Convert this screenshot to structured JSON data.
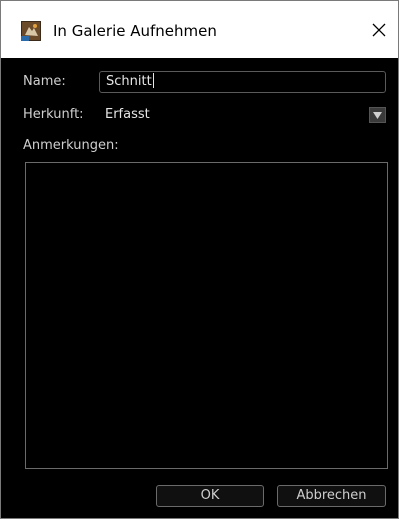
{
  "window": {
    "title": "In Galerie Aufnehmen",
    "app_icon": "gallery-app-icon",
    "close_icon": "close-icon"
  },
  "form": {
    "name_label": "Name:",
    "name_value": "Schnitt",
    "origin_label": "Herkunft:",
    "origin_value": "Erfasst",
    "notes_label": "Anmerkungen:",
    "notes_value": ""
  },
  "buttons": {
    "ok_label": "OK",
    "cancel_label": "Abbrechen"
  },
  "colors": {
    "background": "#000000",
    "titlebar": "#ffffff",
    "text": "#cfcfcf",
    "border": "#6a6a6a"
  }
}
